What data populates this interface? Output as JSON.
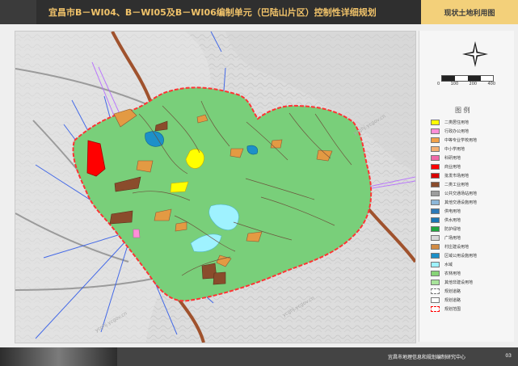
{
  "header": {
    "title": "宜昌市B－WI04、B－WI05及B－WI06编制单元（巴陆山片区）控制性详细规划",
    "right_label": "现状土地利用图"
  },
  "legend": {
    "title": "图 例",
    "items": [
      {
        "label": "二类居住用地",
        "color": "#ffff00"
      },
      {
        "label": "行政办公用地",
        "color": "#ff8fd8"
      },
      {
        "label": "中等专业学校用地",
        "color": "#f3a24a"
      },
      {
        "label": "中小学用地",
        "color": "#f5b173"
      },
      {
        "label": "科研用地",
        "color": "#f06aa8"
      },
      {
        "label": "商业用地",
        "color": "#ff0000"
      },
      {
        "label": "批发市场用地",
        "color": "#d90000"
      },
      {
        "label": "二类工业用地",
        "color": "#8a4c2c"
      },
      {
        "label": "公共交通场站用地",
        "color": "#9d9d9d"
      },
      {
        "label": "其他交通设施用地",
        "color": "#8eb7d8"
      },
      {
        "label": "供电用地",
        "color": "#2d79b7"
      },
      {
        "label": "供水用地",
        "color": "#1a76b5"
      },
      {
        "label": "防护绿地",
        "color": "#21a63f"
      },
      {
        "label": "广场用地",
        "color": "#d7d7d7"
      },
      {
        "label": "村庄建设用地",
        "color": "#d28b43"
      },
      {
        "label": "区域公用设施用地",
        "color": "#1d90c8"
      },
      {
        "label": "水域",
        "color": "#9ff2ff"
      },
      {
        "label": "农林用地",
        "color": "#87d477"
      },
      {
        "label": "其他非建设用地",
        "color": "#a8e49a"
      },
      {
        "label": "规划道路",
        "color": "#ffffff"
      },
      {
        "label": "规划道路",
        "color": "#ffffff"
      },
      {
        "label": "规划范围",
        "color": "#ff0000"
      }
    ]
  },
  "scale": {
    "labels": [
      "0",
      "100",
      "200",
      "400"
    ]
  },
  "footer": {
    "org": "宜昌市地理信息和规划编制研究中心",
    "page": "03"
  }
}
